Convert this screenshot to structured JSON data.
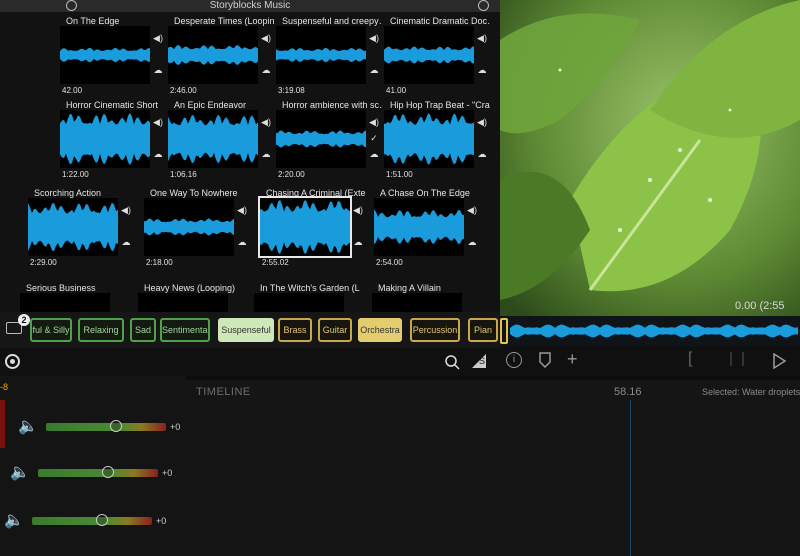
{
  "app": {
    "title": "Storyblocks Music"
  },
  "tiles": [
    {
      "title": "On The Edge",
      "duration": "42.00"
    },
    {
      "title": "Desperate Times (Looping)",
      "duration": "2:46.00"
    },
    {
      "title": "Suspenseful and creepy…",
      "duration": "3:19.08"
    },
    {
      "title": "Cinematic Dramatic Doc…",
      "duration": "41.00"
    },
    {
      "title": "Horror Cinematic Short",
      "duration": "1:22.00"
    },
    {
      "title": "An Epic Endeavor",
      "duration": "1:06.16"
    },
    {
      "title": "Horror ambience with sc…",
      "duration": "2:20.00"
    },
    {
      "title": "Hip Hop Trap Beat - \"Cra…",
      "duration": "1:51.00"
    },
    {
      "title": "Scorching Action",
      "duration": "2:29.00"
    },
    {
      "title": "One Way To Nowhere",
      "duration": "2:18.00"
    },
    {
      "title": "Chasing A Criminal (Exte…",
      "duration": "2:55.02"
    },
    {
      "title": "A Chase On The Edge",
      "duration": "2:54.00"
    },
    {
      "title": "Serious Business",
      "duration": ""
    },
    {
      "title": "Heavy News (Looping)",
      "duration": ""
    },
    {
      "title": "In The Witch's Garden (L…",
      "duration": ""
    },
    {
      "title": "Making A Villain",
      "duration": ""
    }
  ],
  "badge": {
    "count": "2"
  },
  "tags": [
    {
      "label": "ful & Silly",
      "style": "green",
      "selected": false
    },
    {
      "label": "Relaxing",
      "style": "green",
      "selected": false
    },
    {
      "label": "Sad",
      "style": "green",
      "selected": false
    },
    {
      "label": "Sentimental",
      "style": "green",
      "selected": false
    },
    {
      "label": "Suspenseful",
      "style": "green",
      "selected": true
    },
    {
      "label": "Brass",
      "style": "gold",
      "selected": false
    },
    {
      "label": "Guitar",
      "style": "gold",
      "selected": false
    },
    {
      "label": "Orchestra",
      "style": "gold",
      "selected": true
    },
    {
      "label": "Percussion",
      "style": "gold",
      "selected": false
    },
    {
      "label": "Pian",
      "style": "gold",
      "selected": false
    }
  ],
  "video": {
    "timecode": "0.00  (2:55"
  },
  "timeline": {
    "label": "TIMELINE",
    "time": "58.16",
    "selected_text": "Selected: Water droplets"
  },
  "mixer": {
    "corner_value": "-8",
    "rows": [
      {
        "db": "+0",
        "level": 0.58
      },
      {
        "db": "+0",
        "level": 0.58
      },
      {
        "db": "+0",
        "level": 0.58
      }
    ]
  },
  "colors": {
    "waveform": "#1a9bdc",
    "accent_green": "#4fa24a",
    "accent_gold": "#c8a84b",
    "selected_green": "#cfe8b9",
    "selected_gold": "#e3cd6f"
  },
  "icons": [
    "speaker-icon",
    "cloud-icon",
    "checkmark-icon",
    "search-icon",
    "storyblocks-icon",
    "info-icon",
    "marker-icon",
    "add-icon",
    "play-icon",
    "record-icon"
  ]
}
